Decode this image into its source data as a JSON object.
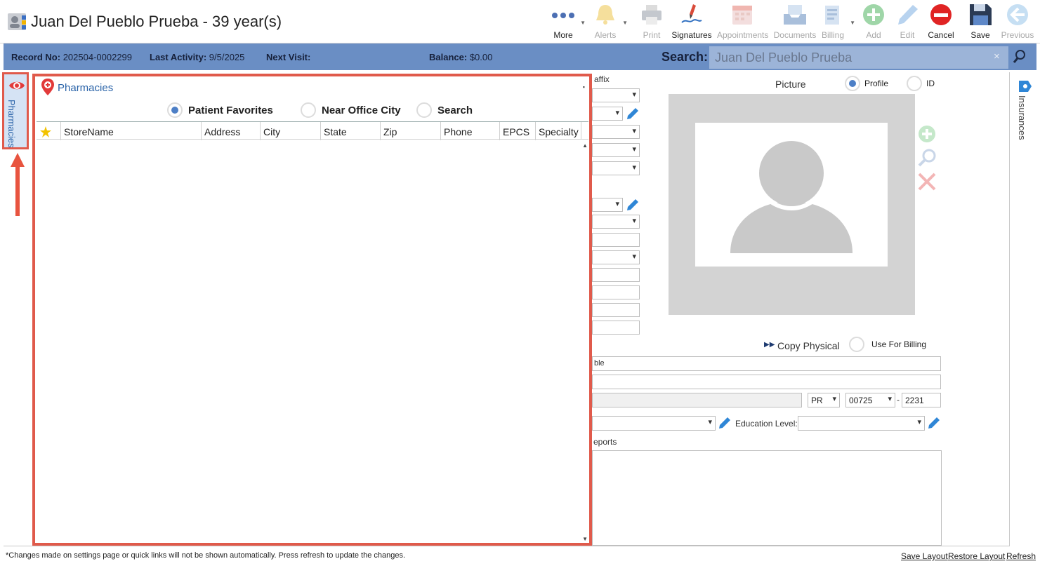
{
  "header": {
    "title": "Juan Del Pueblo Prueba - 39 year(s)",
    "toolbar": [
      {
        "label": "More",
        "icon": "more-dots-icon",
        "enabled": true
      },
      {
        "label": "Alerts",
        "icon": "bell-icon",
        "enabled": false
      },
      {
        "label": "Print",
        "icon": "printer-icon",
        "enabled": false
      },
      {
        "label": "Signatures",
        "icon": "signature-pen-icon",
        "enabled": true
      },
      {
        "label": "Appointments",
        "icon": "calendar-icon",
        "enabled": false
      },
      {
        "label": "Documents",
        "icon": "document-tray-icon",
        "enabled": false
      },
      {
        "label": "Billing",
        "icon": "billing-icon",
        "enabled": false
      },
      {
        "label": "Add",
        "icon": "add-circle-icon",
        "enabled": false
      },
      {
        "label": "Edit",
        "icon": "pencil-icon",
        "enabled": false
      },
      {
        "label": "Cancel",
        "icon": "cancel-circle-icon",
        "enabled": true
      },
      {
        "label": "Save",
        "icon": "floppy-disk-icon",
        "enabled": true
      },
      {
        "label": "Previous",
        "icon": "back-arrow-icon",
        "enabled": false
      }
    ]
  },
  "infobar": {
    "record_label": "Record No:",
    "record_value": "202504-0002299",
    "activity_label": "Last Activity:",
    "activity_value": "9/5/2025",
    "next_visit_label": "Next Visit:",
    "balance_label": "Balance:",
    "balance_value": "$0.00",
    "search_label": "Search:",
    "search_value": "Juan Del Pueblo Prueba",
    "search_clear": "×"
  },
  "side_tabs": {
    "left": "Pharmacies",
    "right": "Insurances"
  },
  "pharmacies": {
    "title": "Pharmacies",
    "radios": [
      {
        "label": "Patient Favorites",
        "selected": true
      },
      {
        "label": "Near Office City",
        "selected": false
      },
      {
        "label": "Search",
        "selected": false
      }
    ],
    "columns": [
      "StoreName",
      "Address",
      "City",
      "State",
      "Zip",
      "Phone",
      "EPCS",
      "Specialty"
    ],
    "rows": []
  },
  "form": {
    "suffix_label_fragment": "affix",
    "picture_label": "Picture",
    "picture_options": [
      {
        "label": "Profile",
        "selected": true
      },
      {
        "label": "ID",
        "selected": false
      }
    ],
    "copy_physical": "Copy Physical",
    "use_for_billing": "Use For Billing",
    "address_fragment": "ble",
    "state_value": "PR",
    "zip_value": "00725",
    "zip_dash": "-",
    "zip_ext_value": "2231",
    "education_label": "Education Level:",
    "reports_fragment": "eports"
  },
  "footer": {
    "note": "*Changes made on settings page or quick links will not be shown automatically. Press refresh to update the changes.",
    "links": [
      "Save Layout",
      "Restore Layout",
      "Refresh"
    ]
  },
  "colors": {
    "infobar": "#6a8ec4",
    "highlight": "#e05a4b",
    "link_blue": "#2a63a8"
  }
}
